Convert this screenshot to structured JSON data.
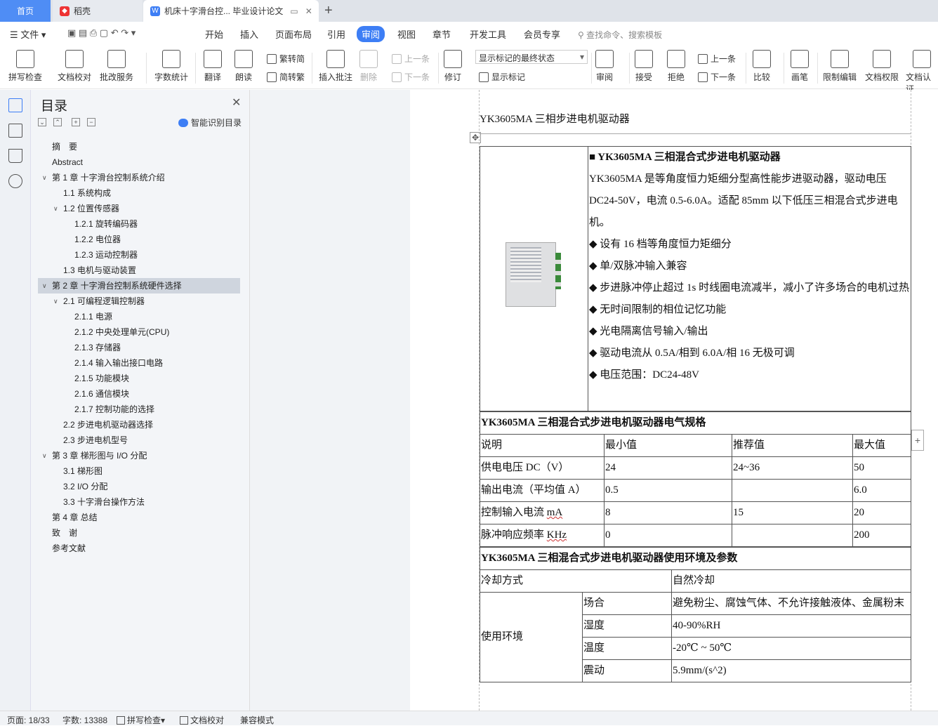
{
  "tabs": {
    "home": "首页",
    "daoke": "稻壳",
    "doc": "机床十字滑台控... 毕业设计论文",
    "add": "+"
  },
  "menu": {
    "file": "文件",
    "items": [
      "开始",
      "插入",
      "页面布局",
      "引用",
      "审阅",
      "视图",
      "章节",
      "开发工具",
      "会员专享"
    ],
    "search": "查找命令、搜索模板"
  },
  "ribbon": {
    "spellcheck": "拼写检查",
    "doc_proof": "文档校对",
    "batch_service": "批改服务",
    "wordcount": "字数统计",
    "translate": "翻译",
    "read_aloud": "朗读",
    "trad_to_simp": "繁转简",
    "simp_to_trad": "简转繁",
    "insert_comment": "插入批注",
    "delete": "删除",
    "prev": "上一条",
    "next": "下一条",
    "track": "修订",
    "mark_state": "显示标记的最终状态",
    "show_marks": "显示标记",
    "review": "审阅",
    "accept": "接受",
    "reject": "拒绝",
    "prev2": "上一条",
    "next2": "下一条",
    "compare": "比较",
    "pen": "画笔",
    "restrict": "限制编辑",
    "doc_rights": "文档权限",
    "doc_cert": "文档认证"
  },
  "nav": {
    "title": "目录",
    "smart": "智能识别目录",
    "items": [
      {
        "t": "摘　要",
        "lv": 1,
        "arrow": ""
      },
      {
        "t": "Abstract",
        "lv": 1,
        "arrow": ""
      },
      {
        "t": "第 1 章  十字滑台控制系统介绍",
        "lv": 1,
        "arrow": "v"
      },
      {
        "t": "1.1 系统构成",
        "lv": 2,
        "arrow": ""
      },
      {
        "t": "1.2 位置传感器",
        "lv": 2,
        "arrow": "v"
      },
      {
        "t": "1.2.1 旋转编码器",
        "lv": 3,
        "arrow": ""
      },
      {
        "t": "1.2.2 电位器",
        "lv": 3,
        "arrow": ""
      },
      {
        "t": "1.2.3 运动控制器",
        "lv": 3,
        "arrow": ""
      },
      {
        "t": "1.3 电机与驱动装置",
        "lv": 2,
        "arrow": ""
      },
      {
        "t": "第 2 章  十字滑台控制系统硬件选择",
        "lv": 1,
        "arrow": "v",
        "sel": true
      },
      {
        "t": "2.1 可编程逻辑控制器",
        "lv": 2,
        "arrow": "v"
      },
      {
        "t": "2.1.1 电源",
        "lv": 3,
        "arrow": ""
      },
      {
        "t": "2.1.2 中央处理单元(CPU)",
        "lv": 3,
        "arrow": ""
      },
      {
        "t": "2.1.3 存储器",
        "lv": 3,
        "arrow": ""
      },
      {
        "t": "2.1.4 输入输出接口电路",
        "lv": 3,
        "arrow": ""
      },
      {
        "t": "2.1.5 功能模块",
        "lv": 3,
        "arrow": ""
      },
      {
        "t": "2.1.6 通信模块",
        "lv": 3,
        "arrow": ""
      },
      {
        "t": "2.1.7 控制功能的选择",
        "lv": 3,
        "arrow": ""
      },
      {
        "t": "2.2 步进电机驱动器选择",
        "lv": 2,
        "arrow": ""
      },
      {
        "t": "2.3 步进电机型号",
        "lv": 2,
        "arrow": ""
      },
      {
        "t": "第 3 章  梯形图与 I/O 分配",
        "lv": 1,
        "arrow": "v"
      },
      {
        "t": "3.1 梯形图",
        "lv": 2,
        "arrow": ""
      },
      {
        "t": "3.2 I/O 分配",
        "lv": 2,
        "arrow": ""
      },
      {
        "t": "3.3 十字滑台操作方法",
        "lv": 2,
        "arrow": ""
      },
      {
        "t": "第 4 章  总结",
        "lv": 1,
        "arrow": ""
      },
      {
        "t": "致　谢",
        "lv": 1,
        "arrow": ""
      },
      {
        "t": "参考文献",
        "lv": 1,
        "arrow": ""
      }
    ]
  },
  "doc": {
    "header": "YK3605MA 三相步进电机驱动器",
    "title": "■ YK3605MA 三相混合式步进电机驱动器",
    "intro": "YK3605MA 是等角度恒力矩细分型高性能步进驱动器，驱动电压 DC24-50V，电流 0.5-6.0A。适配 85mm 以下低压三相混合式步进电机。",
    "features": [
      "◆  设有 16 档等角度恒力矩细分",
      "◆  单/双脉冲输入兼容",
      "◆  步进脉冲停止超过 1s 时线圈电流减半，减小了许多场合的电机过热",
      "◆  无时间限制的相位记忆功能",
      "◆  光电隔离信号输入/输出",
      "◆  驱动电流从 0.5A/相到 6.0A/相 16 无极可调",
      "◆  电压范围：DC24-48V"
    ],
    "spec_title": "YK3605MA 三相混合式步进电机驱动器电气规格",
    "spec_head": [
      "说明",
      "最小值",
      "推荐值",
      "最大值"
    ],
    "spec_rows": [
      [
        "供电电压 DC（V）",
        "24",
        "24~36",
        "50"
      ],
      [
        "输出电流（平均值 A）",
        "0.5",
        "",
        "6.0"
      ],
      [
        "控制输入电流 mA",
        "8",
        "15",
        "20"
      ],
      [
        "脉冲响应频率 KHz",
        "0",
        "",
        "200"
      ]
    ],
    "env_title": "YK3605MA 三相混合式步进电机驱动器使用环境及参数",
    "cooling_label": "冷却方式",
    "cooling_val": "自然冷却",
    "env_label": "使用环境",
    "env_rows": [
      [
        "场合",
        "避免粉尘、腐蚀气体、不允许接触液体、金属粉末"
      ],
      [
        "湿度",
        "40-90%RH"
      ],
      [
        "温度",
        "-20℃ ~ 50℃"
      ],
      [
        "震动",
        "5.9mm/(s^2)"
      ]
    ]
  },
  "status": {
    "page": "页面: 18/33",
    "words": "字数: 13388",
    "spell": "拼写检查",
    "proof": "文档校对",
    "compat": "兼容模式"
  }
}
